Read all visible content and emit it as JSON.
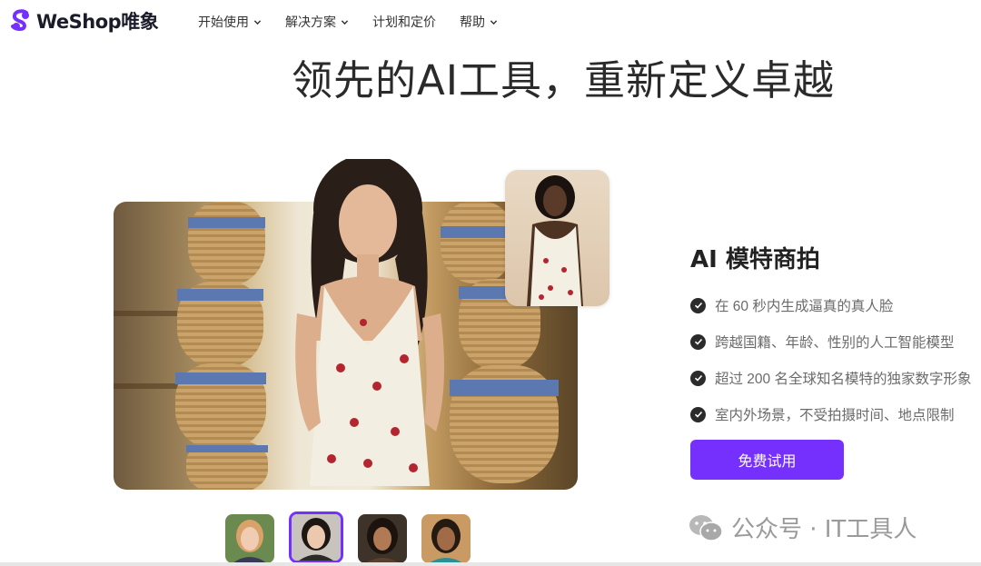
{
  "brand": {
    "name": "WeShop唯象",
    "accent": "#7530fe"
  },
  "nav": {
    "items": [
      {
        "label": "开始使用",
        "has_dropdown": true
      },
      {
        "label": "解决方案",
        "has_dropdown": true
      },
      {
        "label": "计划和定价",
        "has_dropdown": false
      },
      {
        "label": "帮助",
        "has_dropdown": true
      }
    ]
  },
  "hero": {
    "title": "领先的AI工具，重新定义卓越"
  },
  "feature": {
    "title": "AI 模特商拍",
    "points": [
      "在 60 秒内生成逼真的真人脸",
      "跨越国籍、年龄、性别的人工智能模型",
      "超过 200 名全球知名模特的独家数字形象",
      "室内外场景，不受拍摄时间、地点限制"
    ],
    "cta_label": "免费试用"
  },
  "thumbnails": {
    "count": 4,
    "active_index": 1
  },
  "watermark": {
    "text": "公众号 · IT工具人",
    "icon": "wechat-icon"
  }
}
